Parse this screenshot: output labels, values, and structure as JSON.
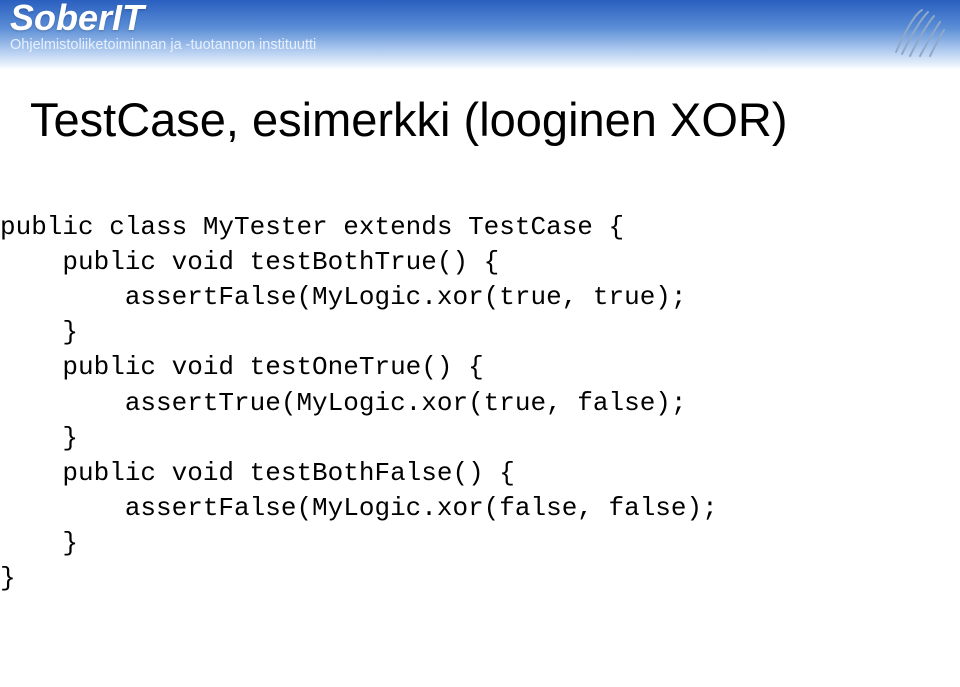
{
  "header": {
    "brand": "SoberIT",
    "subtitle": "Ohjelmistoliiketoiminnan ja -tuotannon instituutti"
  },
  "title": "TestCase, esimerkki (looginen XOR)",
  "code": {
    "line1": "public class MyTester extends TestCase {",
    "line2": "    public void testBothTrue() {",
    "line3": "        assertFalse(MyLogic.xor(true, true);",
    "line4": "    }",
    "line5": "    public void testOneTrue() {",
    "line6": "        assertTrue(MyLogic.xor(true, false);",
    "line7": "    }",
    "line8": "    public void testBothFalse() {",
    "line9": "        assertFalse(MyLogic.xor(false, false);",
    "line10": "    }",
    "line11": "}"
  }
}
